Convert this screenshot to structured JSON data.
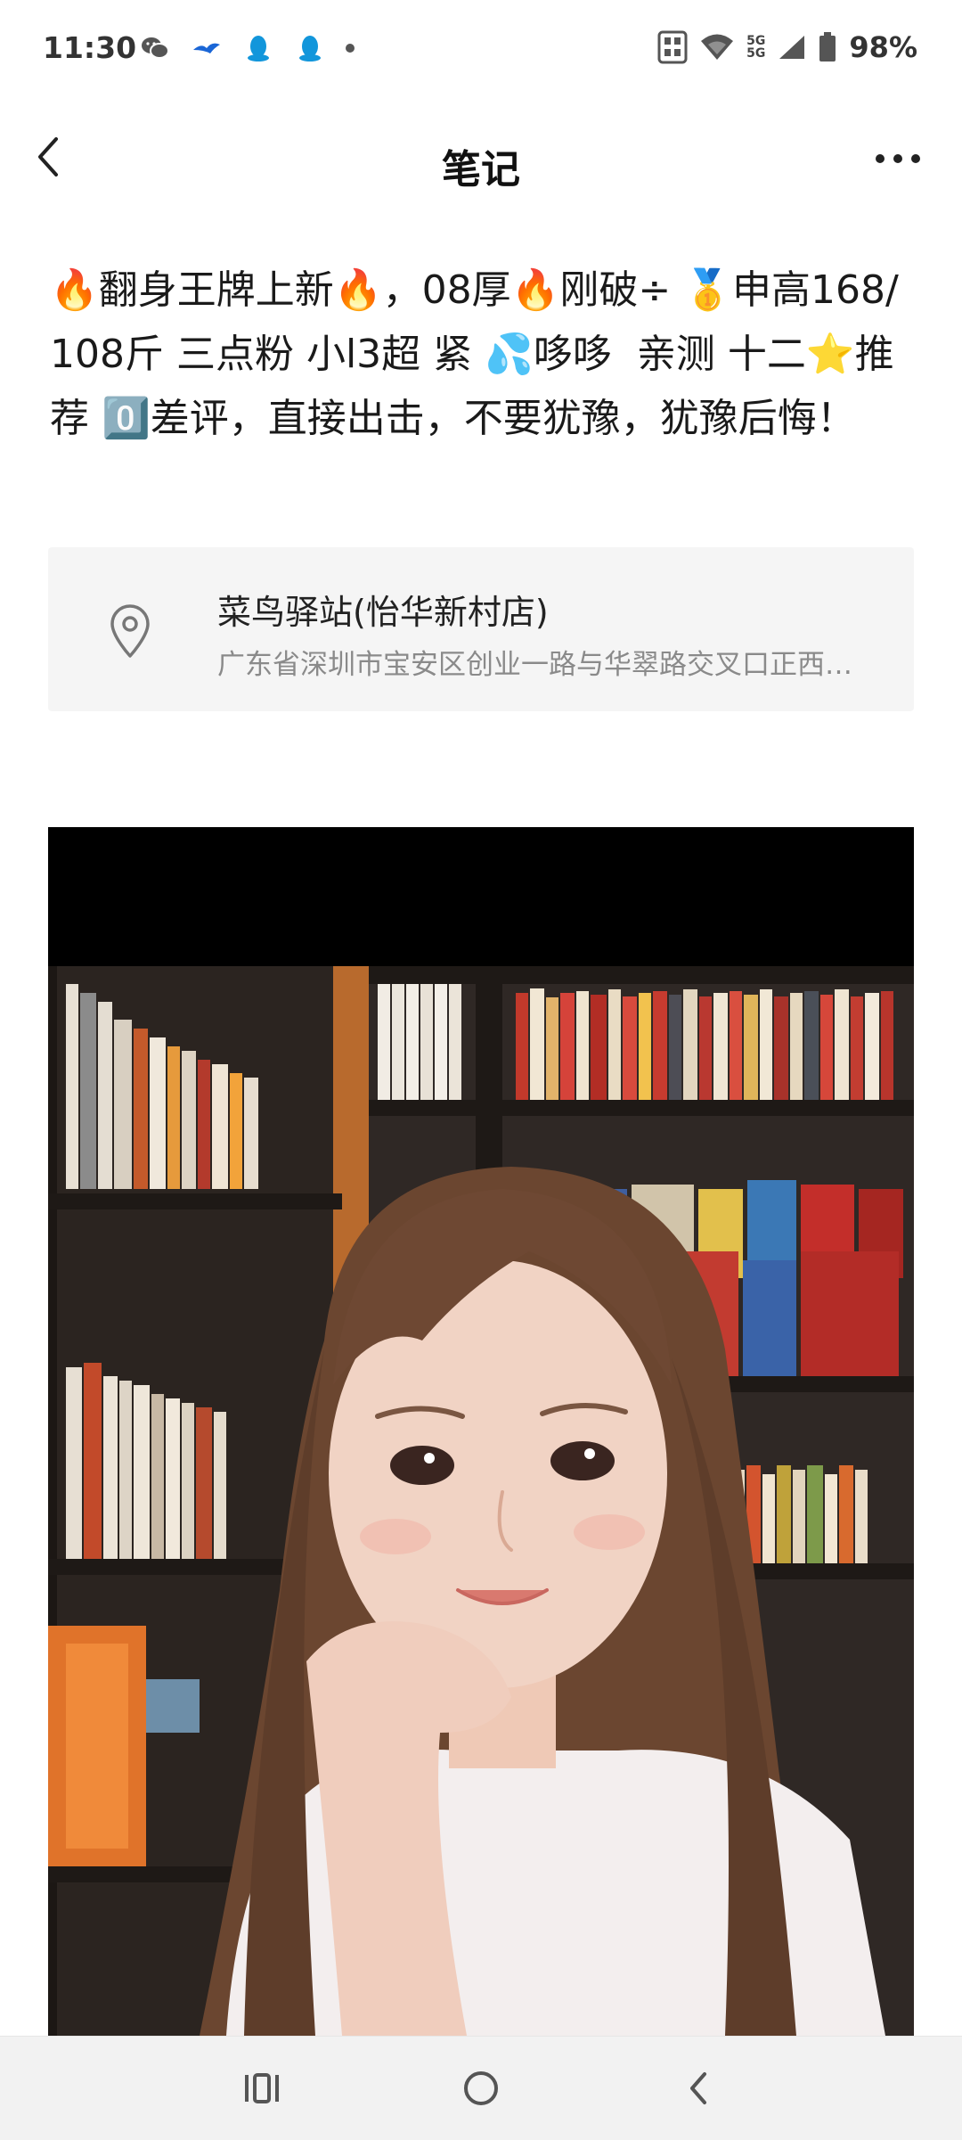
{
  "status_bar": {
    "time": "11:30",
    "battery": "98%",
    "network_top": "5G",
    "network_bottom": "5G",
    "left_icons": [
      "wechat-icon",
      "bird-app-icon",
      "qq-icon",
      "qq-icon",
      "dot-icon"
    ],
    "right_icons": [
      "nfc-icon",
      "wifi-icon",
      "signal-icon",
      "battery-icon"
    ]
  },
  "header": {
    "title": "笔记",
    "back_icon": "chevron-left-icon",
    "more_icon": "more-dots-icon"
  },
  "post": {
    "text": "🔥翻身王牌上新🔥，08厚🔥刚破÷ 🥇申高168/108斤 三点粉 小l3超 紧 💦哆哆  亲测 十二⭐推荐 0️⃣差评，直接出击，不要犹豫，犹豫后悔！"
  },
  "location": {
    "name": "菜鸟驿站(怡华新村店)",
    "address": "广东省深圳市宝安区创业一路与华翠路交叉口正西…",
    "icon": "location-pin-icon"
  },
  "media": {
    "type": "photo",
    "colors": {
      "background": "#000000",
      "shelf": "#2a2522",
      "hair": "#6b4630",
      "skin": "#f1d3c4",
      "shirt": "#f3eeee"
    }
  },
  "nav_bar": {
    "recent_icon": "recent-apps-icon",
    "home_icon": "home-circle-icon",
    "back_icon": "back-arrow-icon"
  }
}
